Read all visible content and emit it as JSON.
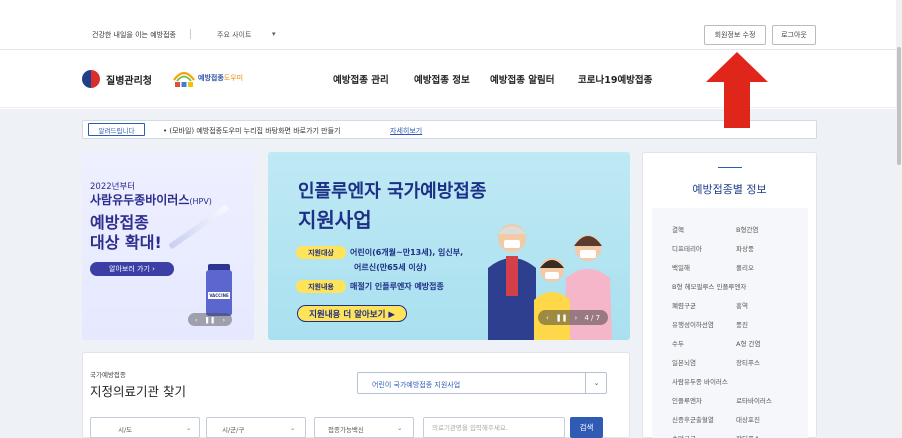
{
  "topbar": {
    "slogan": "건강한 내일을 이는 예방접종",
    "main_sites": "주요 사이트",
    "caret": "▾",
    "edit_member": "회원정보 수정",
    "logout": "로그아웃"
  },
  "nav": {
    "kdca_name": "질병관리청",
    "helper_name_a": "예방접종",
    "helper_name_b": "도우미",
    "items": [
      "예방접종 관리",
      "예방접종 정보",
      "예방접종 알림터",
      "코로나19예방접종"
    ]
  },
  "notice": {
    "tag": "알려드립니다",
    "text": "• (모바일) 예방접종도우미 누리집 바탕화면 바로가기 만들기",
    "link": "자세히보기"
  },
  "banner_hpv": {
    "year": "2022년부터",
    "title_a": "사람유두종바이러스",
    "title_b": "(HPV)",
    "line2": "예방접종",
    "line3": "대상 확대!",
    "button": "알아보러 가기 ›",
    "vial_label": "VACCINE",
    "pager_prev": "‹",
    "pager_pause": "❚❚",
    "pager_next": "›"
  },
  "banner_flu": {
    "title1": "인플루엔자 국가예방접종",
    "title2": "지원사업",
    "tag1": "지원대상",
    "desc1a": "어린이(6개월~만13세), 임신부,",
    "desc1b": "어르신(만65세 이상)",
    "tag2": "지원내용",
    "desc2": "매절기 인플루엔자 예방접종",
    "cta": "지원내용 더 알아보기 ▶",
    "pager_prev": "‹",
    "pager_pause": "❚❚",
    "pager_next": "›",
    "pager_count": "4 / 7"
  },
  "info_panel": {
    "title": "예방접종별 정보",
    "rows": [
      [
        "결핵",
        "B형간염"
      ],
      [
        "디프테리아",
        "파상풍"
      ],
      [
        "백일해",
        "폴리오"
      ],
      [
        "B형 헤모필루스 인플루엔자",
        ""
      ],
      [
        "폐렴구균",
        "홍역"
      ],
      [
        "유행성이하선염",
        "풍진"
      ],
      [
        "수두",
        "A형 간염"
      ],
      [
        "일본뇌염",
        "장티푸스"
      ],
      [
        "사람유두종 바이러스",
        ""
      ],
      [
        "인플루엔자",
        "로타바이러스"
      ],
      [
        "신증후군출혈열",
        "대상포진"
      ],
      [
        "수막구균",
        "장티푸스"
      ]
    ]
  },
  "search_panel": {
    "small": "국가예방접종",
    "title": "지정의료기관 찾기",
    "select_value": "어린이 국가예방접종 지원사업",
    "select_caret": "⌄",
    "field1": "시/도",
    "field2": "시/군/구",
    "field3": "접종가능백신",
    "field_caret": "⌄",
    "input_placeholder": "의료기관명을 입력해주세요.",
    "search_button": "검색"
  },
  "colors": {
    "accent": "#2f5bb5",
    "navy": "#1d2f86",
    "yellow": "#ffe35a",
    "arrow_red": "#e0261b",
    "background": "#eef1f5"
  }
}
